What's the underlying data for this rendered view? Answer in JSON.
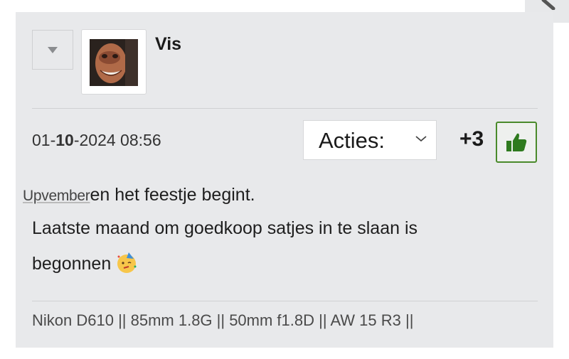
{
  "post": {
    "username": "Vis",
    "timestamp_pre": "01-",
    "timestamp_bold": "10",
    "timestamp_post": "-2024 08:56",
    "actions_label": "Acties:",
    "score": "+3",
    "tag": "Upvember",
    "line1_text": "en het feestje begint.",
    "line2_text": "Laatste maand om goedkoop satjes in te slaan is",
    "line3_text": "begonnen",
    "signature": "Nikon D610 || 85mm 1.8G || 50mm f1.8D || AW 15 R3 ||"
  },
  "icons": {
    "corner": "edit-icon",
    "toggle": "triangle-down-icon",
    "actions_chevron": "chevron-down-icon",
    "like": "thumbs-up-icon",
    "emoji": "party-face-emoji"
  },
  "colors": {
    "post_background": "#e8e9eb",
    "like_border": "#4a8a2b",
    "like_icon": "#2e7a1e"
  }
}
